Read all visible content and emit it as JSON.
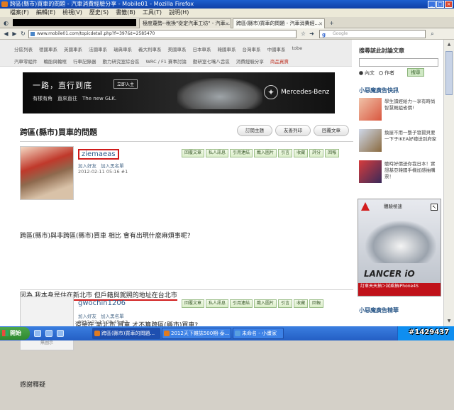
{
  "window": {
    "title": "跨區(縣市)買車的問題 - 汽車消費經驗分享 - Mobile01 - Mozilla Firefox"
  },
  "menu": [
    "檔案(F)",
    "編輯(E)",
    "檢視(V)",
    "歷史(S)",
    "書籤(B)",
    "工具(T)",
    "說明(H)"
  ],
  "tabs": [
    {
      "label": "極度蔑勢--稅換\"從定汽車工坊\" - 汽車..."
    },
    {
      "label": "跨區(縣市)買車的問題 - 汽車消費經..."
    }
  ],
  "nav": {
    "url": "www.mobile01.com/topicdetail.php?f=397&t=2585470",
    "search_placeholder": "Google"
  },
  "categories_row1": [
    "分區列表",
    "德國車系",
    "英國車系",
    "法國車系",
    "瑞典車系",
    "義大利車系",
    "美國車系",
    "日本車系",
    "韓國車系",
    "台灣車系",
    "中國車系",
    "tobe"
  ],
  "categories_row2": [
    "汽車零組件",
    "輪胎與輪框",
    "行車記錄器",
    "動力研究室綜合區",
    "WRC / F1 賽事討論",
    "動研室七嘴八舌區",
    "消費經驗分享",
    "商品買賣"
  ],
  "banner": {
    "headline": "一路，直行到底",
    "cta": "立即入主",
    "subline": "有樣有角　直來直往　The new GLK.",
    "brand": "Mercedes-Benz"
  },
  "thread": {
    "title": "跨區(縣市)買車的問題",
    "buttons": [
      "訂閱主題",
      "友善列印",
      "回覆文章"
    ]
  },
  "post_actions": [
    "回覆文章",
    "私人訊息",
    "引用連結",
    "載入圖片",
    "引言",
    "收藏",
    "評分",
    "回報"
  ],
  "posts": [
    {
      "user": "ziemaeas",
      "link_add_friend": "加入好友",
      "link_add_black": "加入黑名單",
      "date": "2012-02-11 05:16 #1",
      "lines": [
        "跨區(縣市)與非跨區(縣市)買車 相比 會有出現什麼麻煩事呢?",
        "",
        "因為 我本身是住在新北市 但戶籍與駕照的地址在台北市",
        "那我應該在 台北市 還是在 新北市 買車 才不算跨區(縣市)買車?",
        "",
        "感謝釋疑"
      ]
    },
    {
      "user": "gwochin1206",
      "link_add_friend": "加入好友",
      "link_add_black": "加入黑名單",
      "date": "2012-02-11 08:45 #2",
      "avatar_caption": "無圖示"
    }
  ],
  "sidebar": {
    "search_title": "搜尋該此討論文章",
    "radio_content": "內文",
    "radio_author": "作者",
    "search_button": "搜尋",
    "ads_title": "小惡魔廣告快訊",
    "ads": [
      {
        "text": "學生讀經給力～享有時尚智慧概組省價!"
      },
      {
        "text": "換屋不用一整子發揚貝要一下子IKEA好禮送到府家"
      },
      {
        "text": "聽時好價送你我日本！實證基亞韓國手機加感抽購票！"
      }
    ],
    "mitsu": {
      "caption": "體驗極速",
      "model": "LANCER iO",
      "promo": "訂車天天抽＞試乘抽iPhone4S"
    },
    "bottom_title": "小惡魔廣告精華"
  },
  "taskbar": {
    "start": "開始",
    "items": [
      {
        "label": "跨區(縣市)買車的問題..."
      },
      {
        "label": "2012天下雜誌500期-泰..."
      },
      {
        "label": "未命名 - 小畫家"
      }
    ],
    "watermark": "#1429437"
  }
}
